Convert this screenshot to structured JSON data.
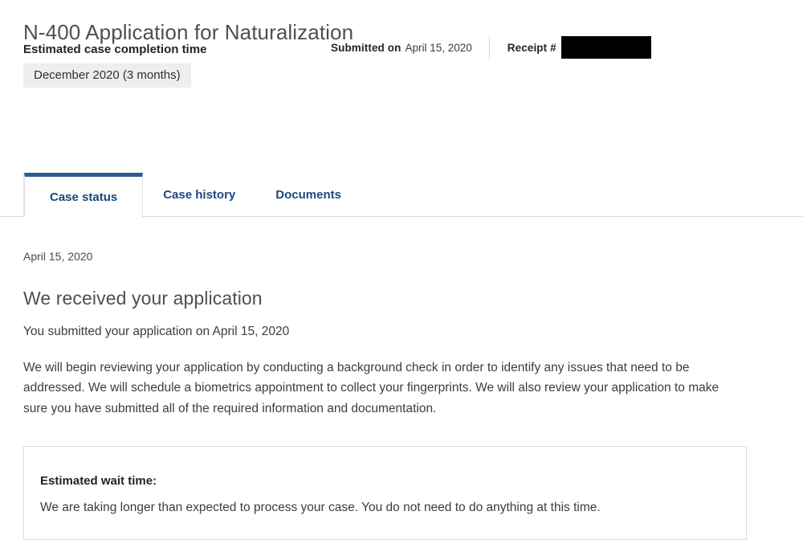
{
  "header": {
    "page_title": "N-400 Application for Naturalization",
    "completion_label": "Estimated case completion time",
    "completion_value": "December 2020 (3 months)",
    "submitted_label": "Submitted on",
    "submitted_value": "April 15, 2020",
    "receipt_label": "Receipt #",
    "receipt_value": ""
  },
  "tabs": [
    {
      "label": "Case status",
      "active": true
    },
    {
      "label": "Case history",
      "active": false
    },
    {
      "label": "Documents",
      "active": false
    }
  ],
  "status": {
    "date": "April 15, 2020",
    "heading": "We received your application",
    "submitted_line": "You submitted your application on April 15, 2020",
    "paragraph": "We will begin reviewing your application by conducting a background check in order to identify any issues that need to be addressed. We will schedule a biometrics appointment to collect your fingerprints. We will also review your application to make sure you have submitted all of the required information and documentation."
  },
  "wait_panel": {
    "title": "Estimated wait time:",
    "text": "We are taking longer than expected to process your case. You do not need to do anything at this time."
  },
  "colors": {
    "tab_accent": "#2d5c91",
    "tab_text": "#1b4a7d",
    "chip_background": "#eeeeee",
    "redaction": "#000000",
    "border": "#dcdcdc",
    "heading_text": "#4f4f4f"
  }
}
